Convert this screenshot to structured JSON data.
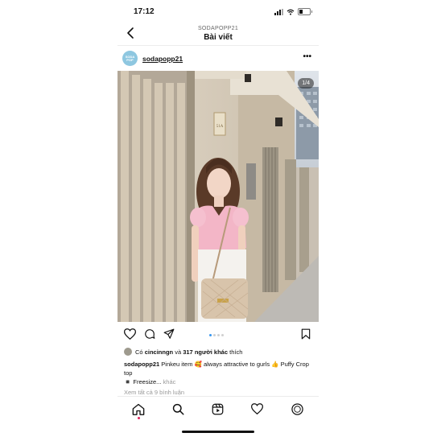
{
  "status_bar": {
    "time": "17:12"
  },
  "header": {
    "username": "SODAPOPP21",
    "title": "Bài viết"
  },
  "post": {
    "avatar_text": "SODA POP",
    "username": "sodapopp21",
    "image_counter": "1/4",
    "door_sign": "51A",
    "likes": {
      "prefix": "Có",
      "first_user": "cincinngn",
      "and": "và",
      "others": "317 người khác",
      "suffix": "thích"
    },
    "caption": {
      "username": "sodapopp21",
      "text": "Pinkeu item 🥰 always attractive to gurls 👍 Puffy Crop top",
      "line2": "◾️ Freesize...",
      "more": "khác"
    },
    "view_comments": "Xem tất cả 9 bình luận"
  },
  "colors": {
    "accent": "#3897f0",
    "notification": "#e0245e",
    "avatar": "#8ec7e0"
  },
  "icons": [
    "back-icon",
    "more-icon",
    "heart-icon",
    "comment-icon",
    "share-icon",
    "bookmark-icon",
    "home-icon",
    "search-icon",
    "reels-icon",
    "activity-icon",
    "profile-icon"
  ]
}
